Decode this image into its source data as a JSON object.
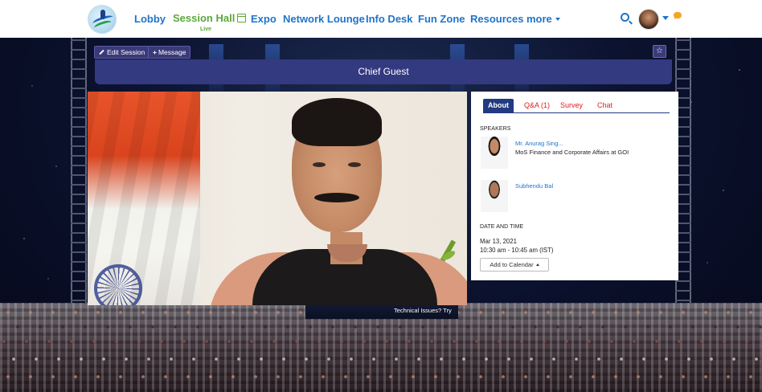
{
  "nav": {
    "items": [
      "Lobby",
      "Session Hall",
      "Expo",
      "Network Lounge",
      "Info Desk",
      "Fun Zone",
      "Resources",
      "more"
    ],
    "session_hall_sub": "Live"
  },
  "session": {
    "edit_label": "Edit Session",
    "message_label": "Message",
    "title": "Chief Guest",
    "tech_issues": "Technical Issues? Try"
  },
  "panel": {
    "tabs": [
      "About",
      "Q&A (1)",
      "Survey",
      "Chat"
    ],
    "speakers_label": "SPEAKERS",
    "speakers": [
      {
        "name": "Mr. Anurag Sing...",
        "role": "MoS Finance and Corporate Affairs at GOI"
      },
      {
        "name": "Subhendu Bal",
        "role": ""
      }
    ],
    "date_label": "DATE AND TIME",
    "date": "Mar 13, 2021",
    "time": "10:30 am - 10:45 am (IST)",
    "calendar_button": "Add to Calendar"
  },
  "colors": {
    "nav_blue": "#1f74c8",
    "nav_active_green": "#5aa83a",
    "title_bar": "#333a80",
    "tab_active": "#223a82",
    "tab_red": "#e02020"
  },
  "icons": [
    "calendar-icon",
    "chevron-down-icon",
    "search-icon",
    "avatar",
    "chat-bubble-icon",
    "pencil-icon",
    "plus-icon",
    "star-icon",
    "caret-up-icon"
  ]
}
